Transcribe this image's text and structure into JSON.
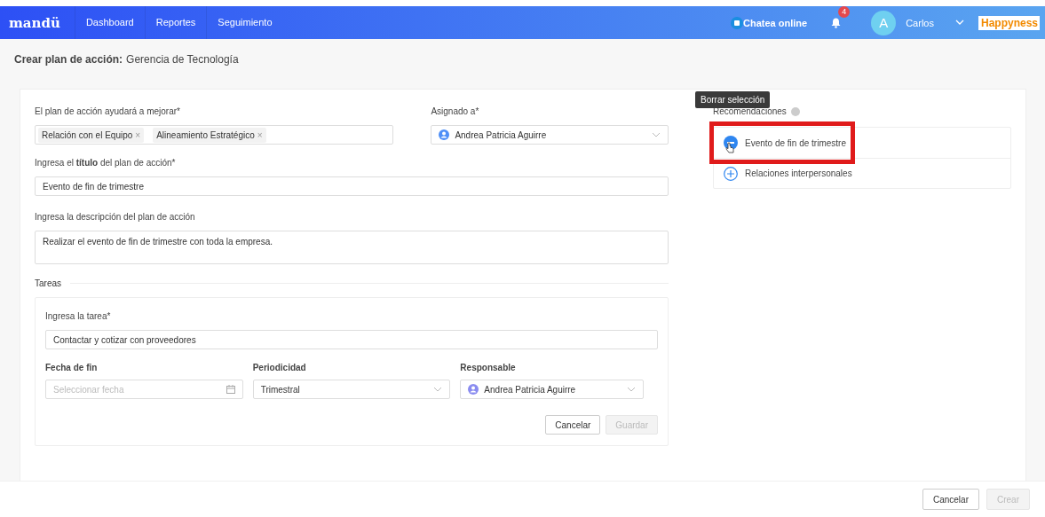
{
  "nav": {
    "logo": "mandü",
    "links": [
      {
        "label": "Dashboard"
      },
      {
        "label": "Reportes"
      },
      {
        "label": "Seguimiento"
      }
    ],
    "chat": "Chatea online",
    "notifications": "4",
    "avatar": "A",
    "user": "Carlos",
    "brand": "Happyness"
  },
  "page_title": {
    "prefix": "Crear plan de acción:",
    "name": "Gerencia de Tecnología"
  },
  "form": {
    "improve": {
      "label": "El plan de acción ayudará a mejorar*",
      "tags": [
        {
          "label": "Relación con el Equipo",
          "remove": "×"
        },
        {
          "label": "Alineamiento Estratégico",
          "remove": "×"
        }
      ]
    },
    "assigned": {
      "label": "Asignado a*",
      "value": "Andrea Patricia Aguirre"
    },
    "title": {
      "label": "Ingresa el **título** del plan de acción*",
      "value": "Evento de fin de trimestre"
    },
    "description": {
      "label": "Ingresa la descripción del plan de acción",
      "value": "Realizar el evento de fin de trimestre con toda la empresa."
    }
  },
  "tasks": {
    "section": "Tareas",
    "task_label": "Ingresa la tarea*",
    "task_value": "Contactar y cotizar con proveedores",
    "end_date": {
      "label": "Fecha de fin",
      "placeholder": "Seleccionar fecha"
    },
    "periodicity": {
      "label": "Periodicidad",
      "value": "Trimestral"
    },
    "responsible": {
      "label": "Responsable",
      "value": "Andrea Patricia Aguirre"
    },
    "buttons": [
      {
        "label": "Cancelar",
        "disabled": false
      },
      {
        "label": "Guardar",
        "disabled": true
      }
    ]
  },
  "recommendations": {
    "title": "Recomendaciones",
    "tooltip": "Borrar selección",
    "items": [
      {
        "label": "Evento de fin de trimestre",
        "selected": true
      },
      {
        "label": "Relaciones interpersonales",
        "selected": false
      }
    ]
  },
  "footer": {
    "buttons": [
      {
        "label": "Cancelar",
        "disabled": false
      },
      {
        "label": "Crear",
        "disabled": true
      }
    ]
  }
}
